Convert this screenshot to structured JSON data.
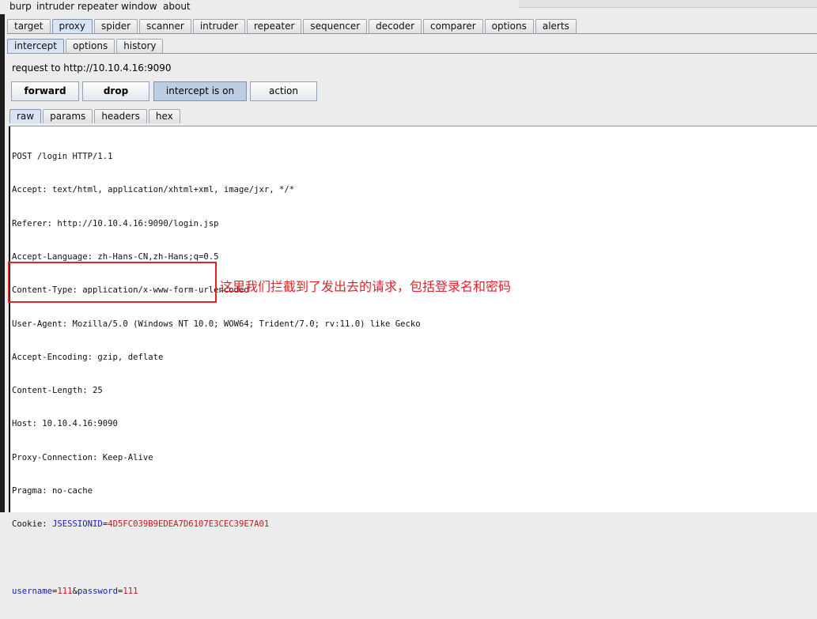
{
  "menu": [
    "burp",
    "intruder",
    "repeater",
    "window",
    "about"
  ],
  "main_tabs": [
    {
      "label": "target"
    },
    {
      "label": "proxy",
      "active": true
    },
    {
      "label": "spider"
    },
    {
      "label": "scanner"
    },
    {
      "label": "intruder"
    },
    {
      "label": "repeater"
    },
    {
      "label": "sequencer"
    },
    {
      "label": "decoder"
    },
    {
      "label": "comparer"
    },
    {
      "label": "options"
    },
    {
      "label": "alerts"
    }
  ],
  "proxy_tabs": [
    {
      "label": "intercept",
      "active": true
    },
    {
      "label": "options"
    },
    {
      "label": "history"
    }
  ],
  "request_label": "request to http://10.10.4.16:9090",
  "buttons": {
    "forward": "forward",
    "drop": "drop",
    "intercept": "intercept is on",
    "action": "action"
  },
  "view_tabs": [
    {
      "label": "raw",
      "active": true
    },
    {
      "label": "params"
    },
    {
      "label": "headers"
    },
    {
      "label": "hex"
    }
  ],
  "request": {
    "lines": [
      "POST /login HTTP/1.1",
      "Accept: text/html, application/xhtml+xml, image/jxr, */*",
      "Referer: http://10.10.4.16:9090/login.jsp",
      "Accept-Language: zh-Hans-CN,zh-Hans;q=0.5",
      "Content-Type: application/x-www-form-urlencoded",
      "User-Agent: Mozilla/5.0 (Windows NT 10.0; WOW64; Trident/7.0; rv:11.0) like Gecko",
      "Accept-Encoding: gzip, deflate",
      "Content-Length: 25",
      "Host: 10.10.4.16:9090",
      "Proxy-Connection: Keep-Alive",
      "Pragma: no-cache"
    ],
    "cookie_prefix": "Cookie: ",
    "cookie_name": "JSESSIONID",
    "cookie_eq": "=",
    "cookie_value": "4D5FC039B9EDEA7D6107E3CEC39E7A01",
    "body": {
      "k1": "username",
      "v1": "111",
      "amp": "&",
      "k2": "password",
      "v2": "111",
      "eq": "="
    }
  },
  "annotation": "这里我们拦截到了发出去的请求，包括登录名和密码",
  "colors": {
    "annotation": "#e0222b",
    "param_name": "#1a1ab8",
    "param_value": "#c01818"
  }
}
